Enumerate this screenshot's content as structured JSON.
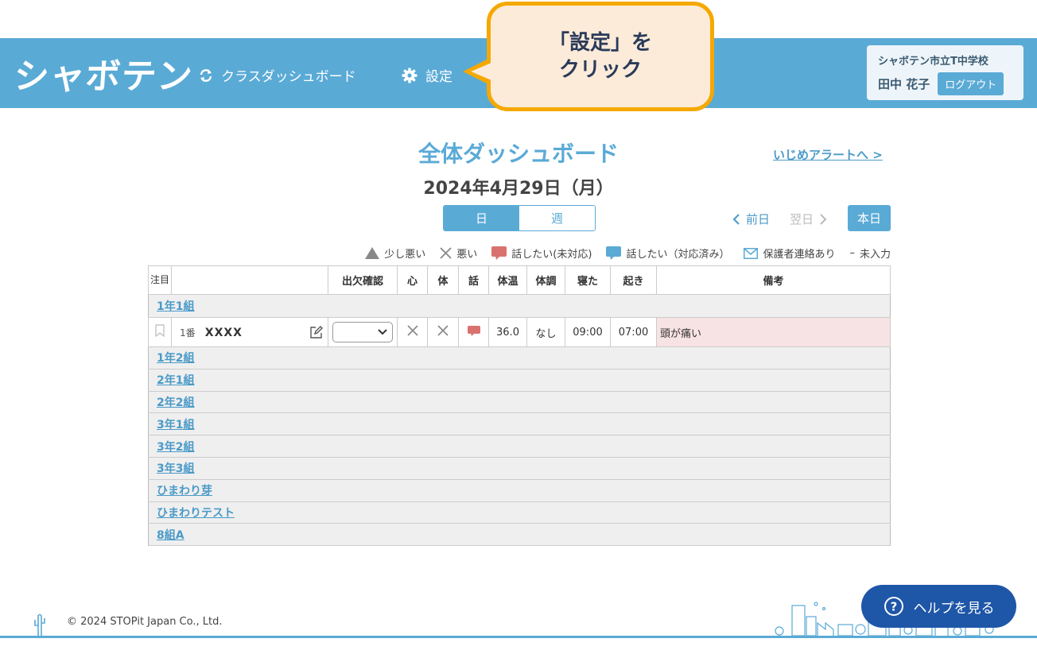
{
  "header": {
    "logo": "シャボテン",
    "nav": [
      {
        "label": "クラスダッシュボード",
        "icon": "refresh-icon"
      },
      {
        "label": "設定",
        "icon": "gear-icon"
      }
    ],
    "school": "シャボテン市立T中学校",
    "user_name": "田中 花子",
    "logout_label": "ログアウト"
  },
  "callout": {
    "line1": "「設定」を",
    "line2": "クリック"
  },
  "main": {
    "title": "全体ダッシュボード",
    "bully_link": "いじめアラートへ >",
    "date": "2024年4月29日（月）",
    "toggle_day": "日",
    "toggle_week": "週",
    "prev_label": "前日",
    "next_label": "翌日",
    "today_label": "本日"
  },
  "legend": {
    "slightly_bad": "少し悪い",
    "bad": "悪い",
    "want_talk_unhandled": "話したい(未対応)",
    "want_talk_handled": "話したい（対応済み）",
    "guardian_contact": "保護者連絡あり",
    "not_entered": "未入力"
  },
  "table": {
    "headers": {
      "flag": "注目",
      "attendance": "出欠確認",
      "mind": "心",
      "body": "体",
      "talk": "話",
      "temp": "体温",
      "condition": "体調",
      "sleep": "寝た",
      "wake": "起き",
      "notes": "備考"
    },
    "first_group": "1年1組",
    "student": {
      "num": "1番",
      "name": "XXXX",
      "temp": "36.0",
      "condition": "なし",
      "sleep": "09:00",
      "wake": "07:00",
      "note": "頭が痛い"
    },
    "groups": [
      "1年2組",
      "2年1組",
      "2年2組",
      "3年1組",
      "3年2組",
      "3年3組",
      "ひまわり芽",
      "ひまわりテスト",
      "8組A"
    ]
  },
  "footer": {
    "copyright": "© 2024 STOPit Japan Co., Ltd.",
    "help_label": "ヘルプを見る"
  },
  "colors": {
    "primary": "#5aaad6",
    "callout_border": "#f5a800",
    "callout_bg": "#fdebd9",
    "help_button": "#1e56a8",
    "talk_unhandled": "#d9726e",
    "note_bg": "#f7e2e4"
  }
}
